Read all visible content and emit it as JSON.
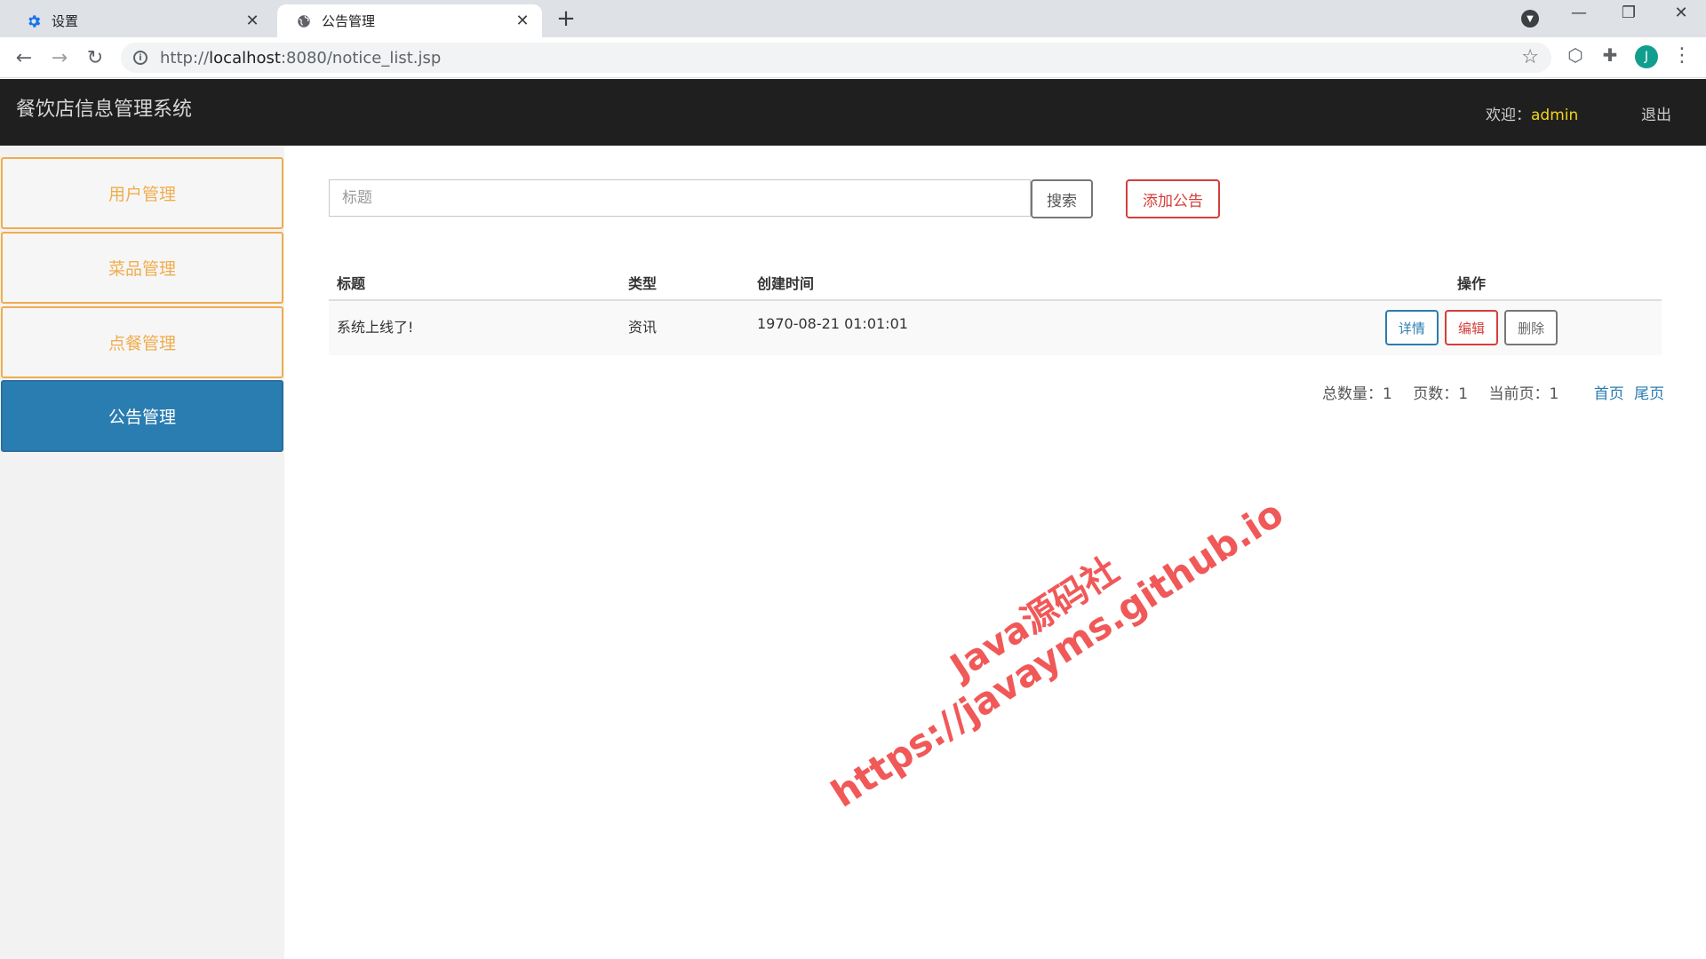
{
  "browser": {
    "tabs": [
      {
        "label": "设置",
        "icon": "gear-icon"
      },
      {
        "label": "公告管理",
        "icon": "globe-icon"
      }
    ],
    "url_scheme": "http://",
    "url_host": "localhost",
    "url_rest": ":8080/notice_list.jsp",
    "avatar_letter": "J"
  },
  "header": {
    "title": "餐饮店信息管理系统",
    "welcome_label": "欢迎：",
    "username": "admin",
    "logout": "退出"
  },
  "sidebar": {
    "items": [
      {
        "label": "用户管理"
      },
      {
        "label": "菜品管理"
      },
      {
        "label": "点餐管理"
      },
      {
        "label": "公告管理",
        "active": true
      }
    ]
  },
  "toolbar": {
    "search_placeholder": "标题",
    "search_label": "搜索",
    "add_label": "添加公告"
  },
  "table": {
    "headers": [
      "标题",
      "类型",
      "创建时间",
      "操作"
    ],
    "rows": [
      {
        "title": "系统上线了!",
        "type": "资讯",
        "created": "1970-08-21 01:01:01",
        "actions": {
          "detail": "详情",
          "edit": "编辑",
          "delete": "删除"
        }
      }
    ]
  },
  "pager": {
    "total": "总数量：1",
    "pages": "页数：1",
    "current": "当前页：1",
    "first": "首页",
    "last": "尾页"
  },
  "watermark": {
    "line1": "Java源码社",
    "line2": "https://javayms.github.io"
  },
  "colors": {
    "accent": "#2a7db1",
    "warning": "#f0ad4e",
    "danger": "#d43f3a",
    "header_bg": "#1f1f1f"
  }
}
